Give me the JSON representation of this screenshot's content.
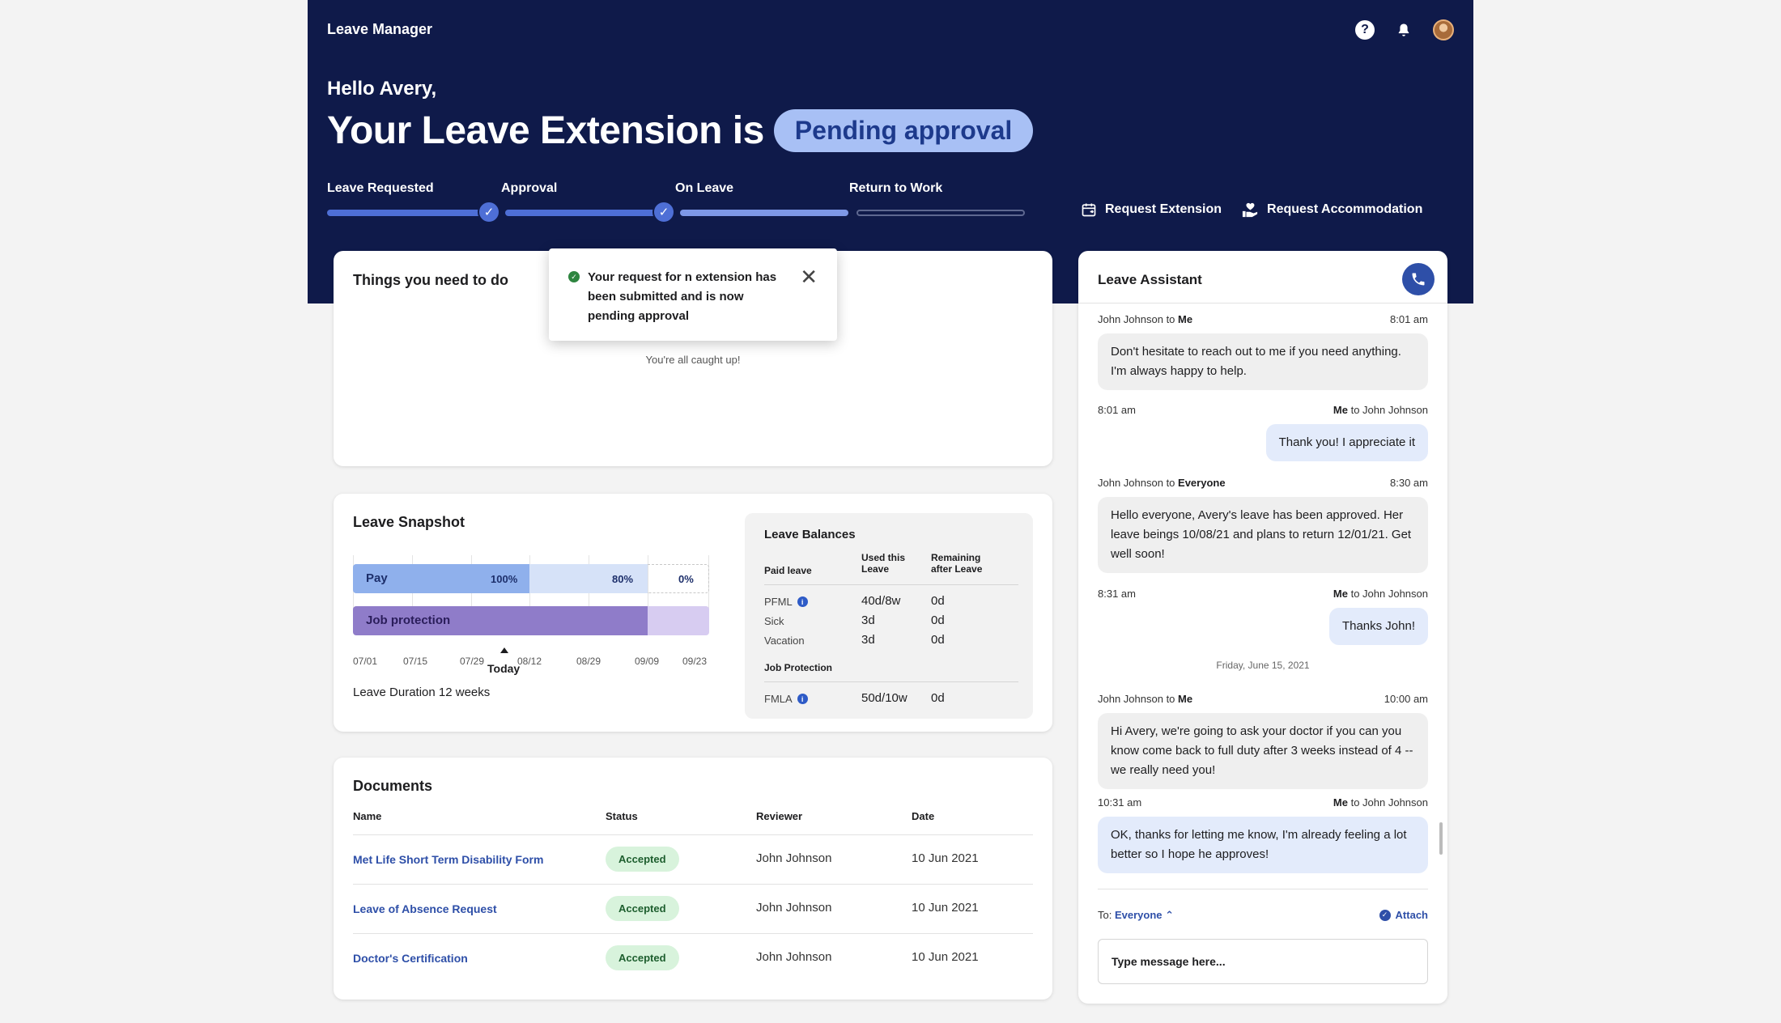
{
  "app": {
    "title": "Leave Manager"
  },
  "hero": {
    "greeting": "Hello Avery,",
    "headline": "Your Leave Extension is",
    "status_pill": "Pending approval"
  },
  "progress": {
    "steps": [
      {
        "label": "Leave Requested",
        "state": "complete"
      },
      {
        "label": "Approval",
        "state": "complete"
      },
      {
        "label": "On Leave",
        "state": "current"
      },
      {
        "label": "Return to Work",
        "state": "upcoming"
      }
    ]
  },
  "actions": {
    "request_extension": "Request Extension",
    "request_accommodation": "Request Accommodation"
  },
  "todo": {
    "title": "Things you need to do",
    "empty_text": "You're all caught up!"
  },
  "toast": {
    "message": "Your request for n extension has been submitted and is now pending approval"
  },
  "snapshot": {
    "title": "Leave Snapshot",
    "duration_text": "Leave Duration 12 weeks",
    "today_label": "Today",
    "pay_label": "Pay",
    "job_label": "Job protection"
  },
  "chart_data": {
    "type": "bar",
    "x_ticks": [
      "07/01",
      "07/15",
      "07/29",
      "08/12",
      "08/29",
      "09/09",
      "09/23"
    ],
    "series": [
      {
        "name": "Pay",
        "segments": [
          {
            "label": "100%",
            "value": 100
          },
          {
            "label": "80%",
            "value": 80
          },
          {
            "label": "0%",
            "value": 0
          }
        ]
      },
      {
        "name": "Job protection",
        "segments": []
      }
    ],
    "today_marker": "Today"
  },
  "balances": {
    "title": "Leave Balances",
    "col_used": "Used this Leave",
    "col_remaining": "Remaining after Leave",
    "paid_heading": "Paid leave",
    "paid": [
      {
        "name": "PFML",
        "used": "40d/8w",
        "remaining": "0d",
        "info": true
      },
      {
        "name": "Sick",
        "used": "3d",
        "remaining": "0d",
        "info": false
      },
      {
        "name": "Vacation",
        "used": "3d",
        "remaining": "0d",
        "info": false
      }
    ],
    "job_heading": "Job Protection",
    "job": [
      {
        "name": "FMLA",
        "used": "50d/10w",
        "remaining": "0d",
        "info": true
      }
    ]
  },
  "documents": {
    "title": "Documents",
    "headers": {
      "name": "Name",
      "status": "Status",
      "reviewer": "Reviewer",
      "date": "Date"
    },
    "rows": [
      {
        "name": "Met Life Short Term Disability Form",
        "status": "Accepted",
        "reviewer": "John Johnson",
        "date": "10 Jun 2021"
      },
      {
        "name": "Leave of Absence Request",
        "status": "Accepted",
        "reviewer": "John Johnson",
        "date": "10 Jun 2021"
      },
      {
        "name": "Doctor's Certification",
        "status": "Accepted",
        "reviewer": "John Johnson",
        "date": "10 Jun 2021"
      }
    ]
  },
  "assistant": {
    "title": "Leave Assistant",
    "messages": [
      {
        "from": "John Johnson",
        "to": "Me",
        "time": "8:01 am",
        "text": "Don't hesitate to reach out to me if you need anything. I'm always happy to help.",
        "mine": false
      },
      {
        "from": "Me",
        "to": "John Johnson",
        "time": "8:01 am",
        "text": "Thank you! I appreciate it",
        "mine": true
      },
      {
        "from": "John Johnson",
        "to": "Everyone",
        "time": "8:30 am",
        "text": "Hello everyone, Avery's leave has been approved. Her leave beings 10/08/21 and plans to return 12/01/21. Get well soon!",
        "mine": false
      },
      {
        "from": "Me",
        "to": "John Johnson",
        "time": "8:31 am",
        "text": "Thanks John!",
        "mine": true
      },
      {
        "from": "John Johnson",
        "to": "Me",
        "time": "10:00 am",
        "text": "Hi Avery, we're going to ask your doctor if you can you know come back to full duty after 3 weeks instead of 4 -- we really need you!",
        "mine": false
      },
      {
        "from": "Me",
        "to": "John Johnson",
        "time": "10:31 am",
        "text": "OK, thanks for letting me know, I'm already feeling a lot better so I hope he approves!",
        "mine": true
      }
    ],
    "day_separator": "Friday, June 15, 2021",
    "to_label": "To:",
    "to_value": "Everyone",
    "attach_label": "Attach",
    "input_placeholder": "Type message here..."
  },
  "colors": {
    "hero_bg": "#0f1a4a",
    "accent": "#4e6fd6",
    "pill_bg": "#a8c0f5",
    "success": "#2e8540"
  }
}
